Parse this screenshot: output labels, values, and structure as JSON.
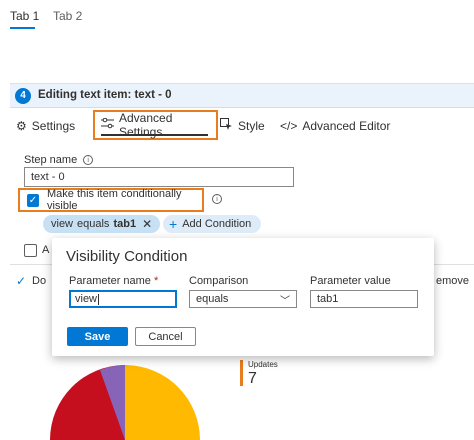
{
  "top_tabs": [
    {
      "label": "Tab 1",
      "active": true
    },
    {
      "label": "Tab 2",
      "active": false
    }
  ],
  "panel": {
    "step_number": "4",
    "title": "Editing text item: text - 0",
    "tabs": [
      {
        "label": "Settings",
        "icon": "gear-icon"
      },
      {
        "label": "Advanced Settings",
        "icon": "sliders-icon",
        "active": true
      },
      {
        "label": "Style",
        "icon": "style-cursor-icon"
      },
      {
        "label": "Advanced Editor",
        "icon": "code-icon"
      }
    ],
    "step_name_label": "Step name",
    "step_name_value": "text - 0",
    "conditional_label": "Make this item conditionally visible",
    "conditional_checked": true,
    "condition_pill": {
      "param": "view",
      "op": "equals",
      "value": "tab1"
    },
    "add_condition_label": "Add Condition",
    "second_checkbox_partial": "A",
    "done_partial": "Do",
    "remove_partial": "emove"
  },
  "dialog": {
    "title": "Visibility Condition",
    "param_name_label": "Parameter name",
    "param_name_value": "view",
    "comparison_label": "Comparison",
    "comparison_value": "equals",
    "param_value_label": "Parameter value",
    "param_value_value": "tab1",
    "save_label": "Save",
    "cancel_label": "Cancel"
  },
  "background_chart": {
    "updates_label": "Updates",
    "updates_value": "7",
    "colors": [
      "#c50f1f",
      "#e87c1e",
      "#ffb900",
      "#8764b8"
    ]
  },
  "colors": {
    "accent": "#0078d4",
    "highlight": "#e87c1e"
  }
}
